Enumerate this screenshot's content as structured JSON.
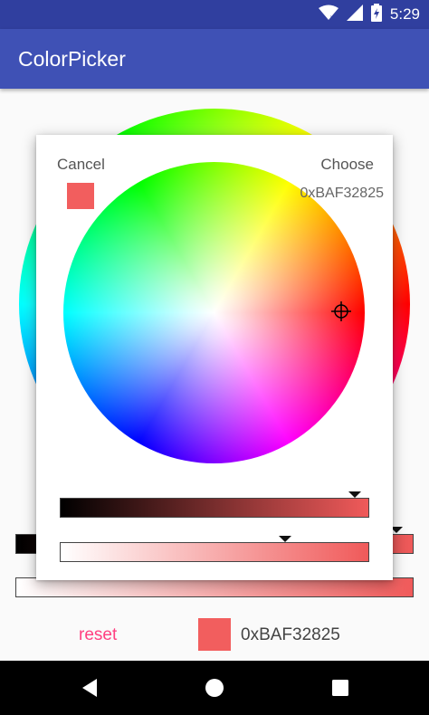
{
  "status_bar": {
    "time": "5:29",
    "icons": [
      "wifi-icon",
      "cell-signal-icon",
      "battery-charging-icon"
    ]
  },
  "app_bar": {
    "title": "ColorPicker"
  },
  "dialog": {
    "cancel_label": "Cancel",
    "choose_label": "Choose",
    "selected_hex": "0xBAF32825",
    "selected_color": "#f25e5e"
  },
  "main": {
    "reset_label": "reset",
    "current_hex": "0xBAF32825",
    "current_color": "#f25e5e"
  },
  "nav_bar": {
    "icons": [
      "back-icon",
      "home-icon",
      "recents-icon"
    ]
  }
}
